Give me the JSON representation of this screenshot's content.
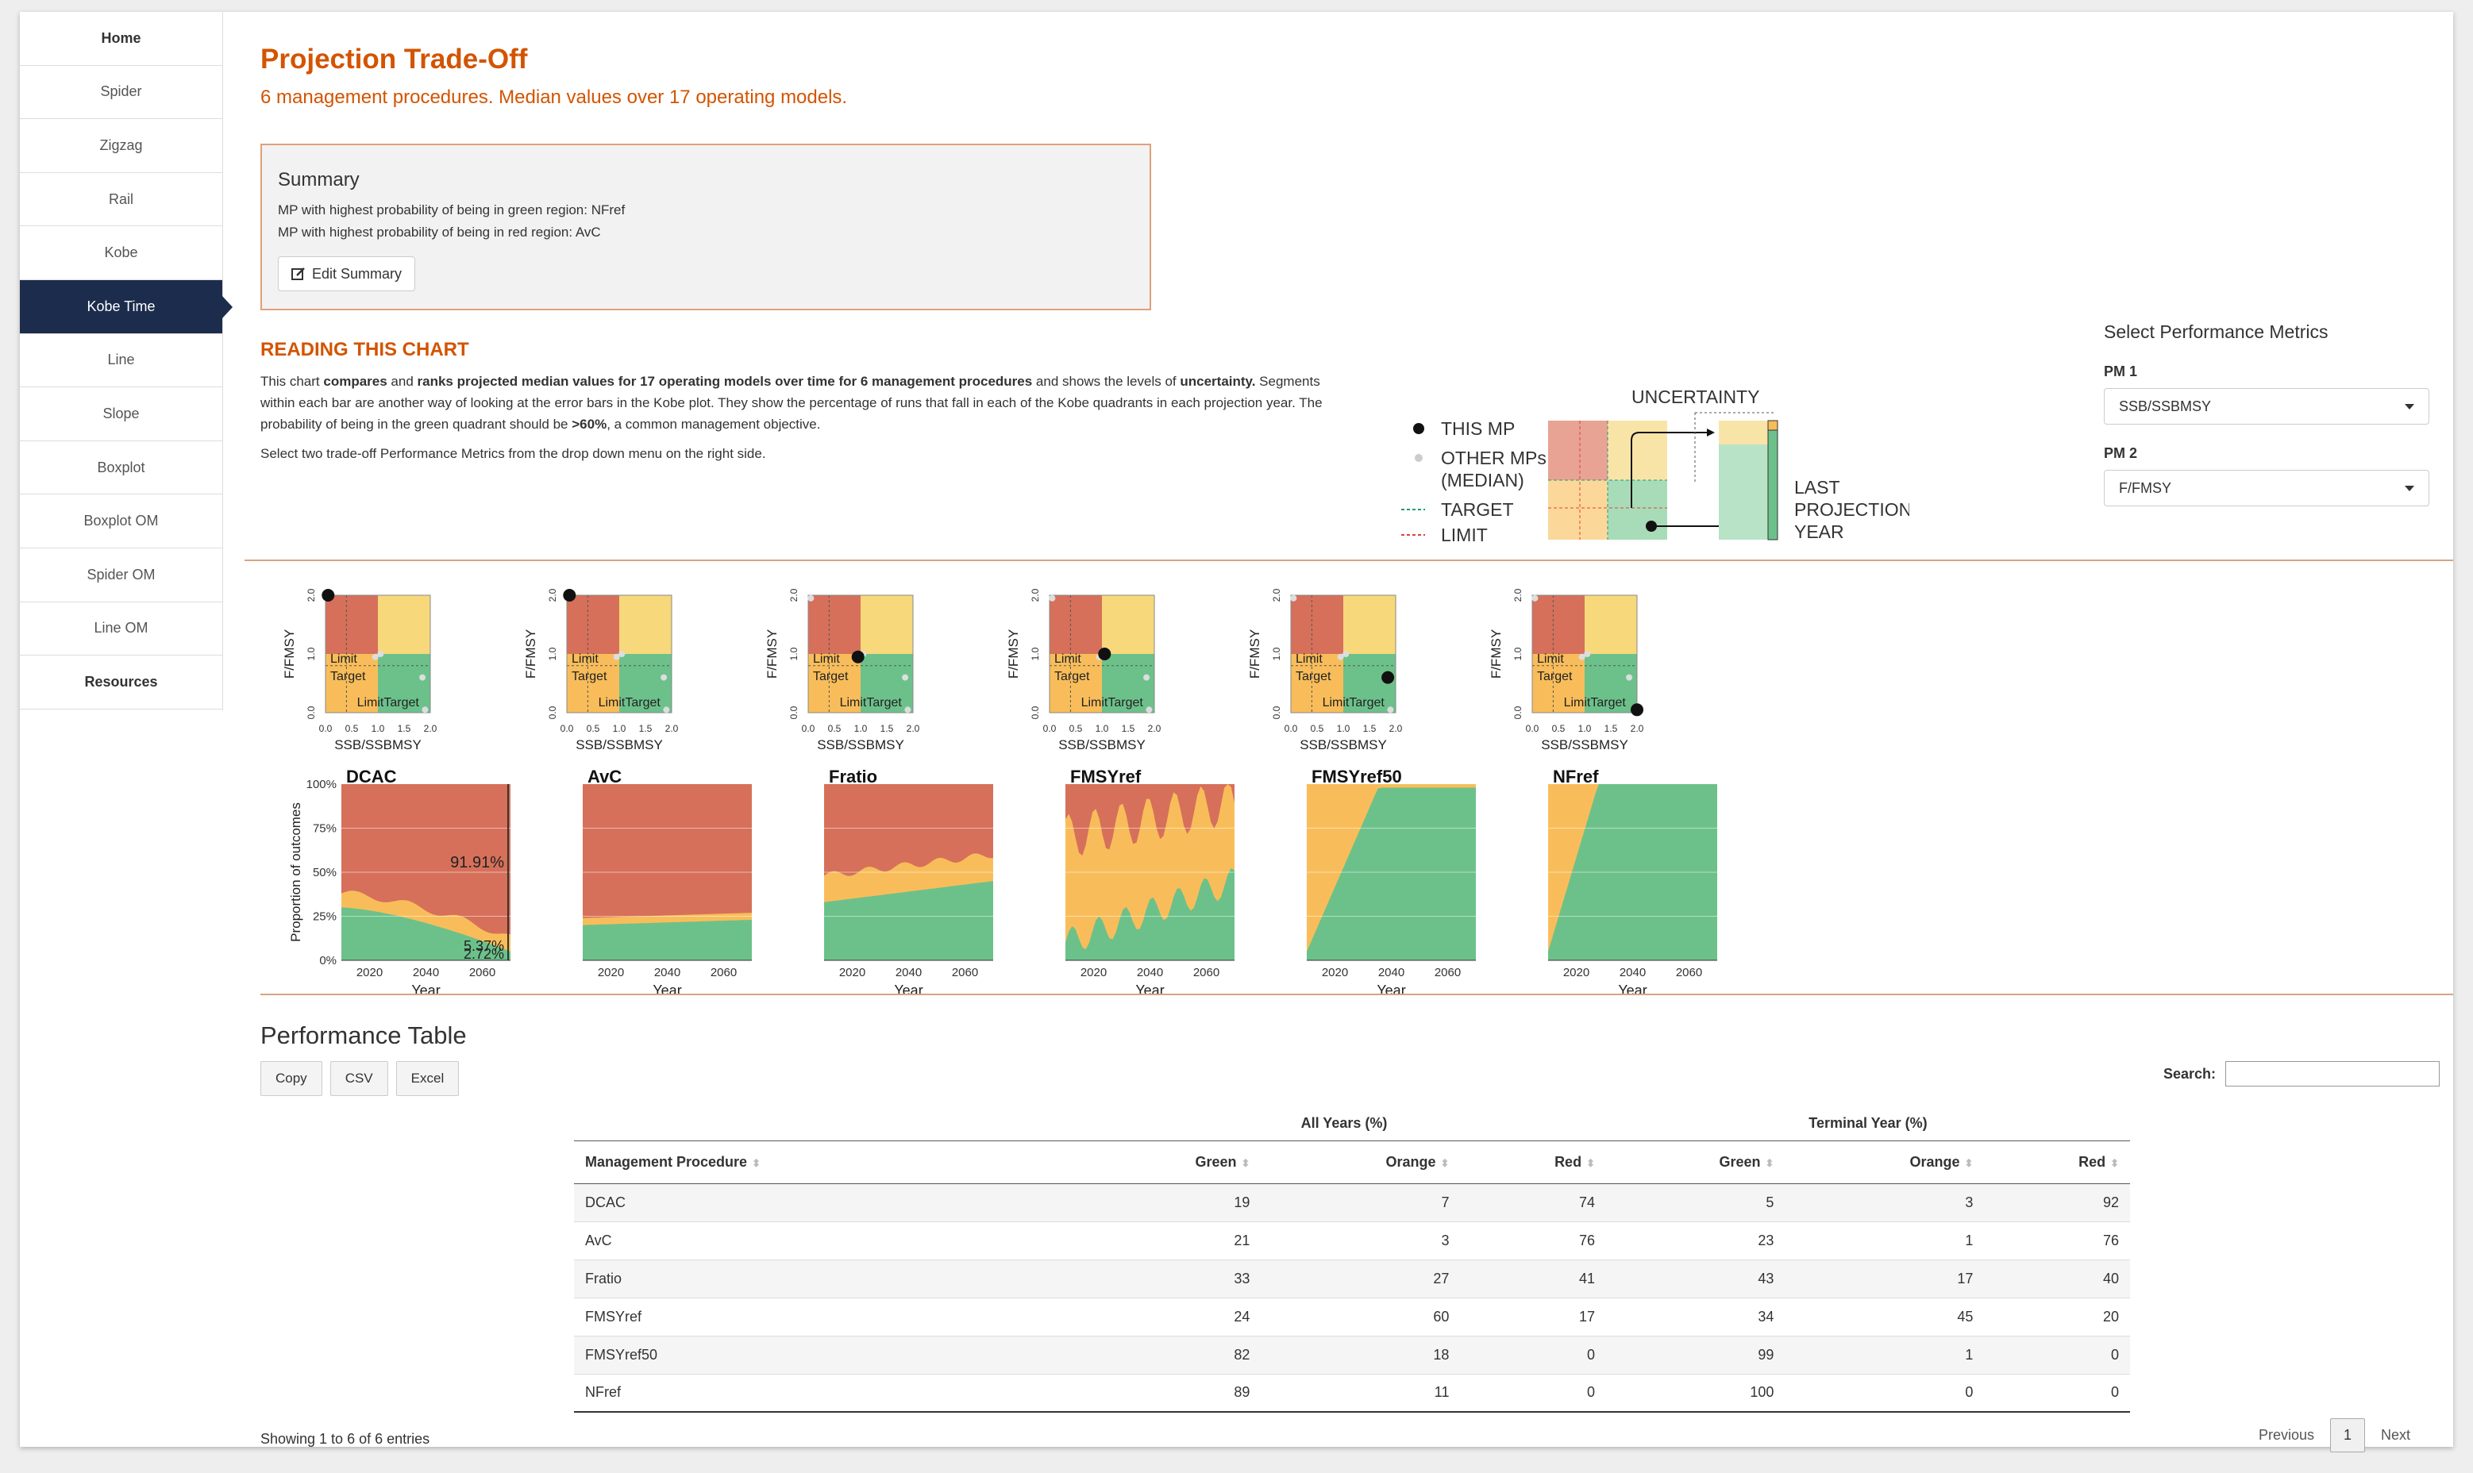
{
  "sidebar": {
    "items": [
      {
        "label": "Home",
        "bold": true
      },
      {
        "label": "Spider"
      },
      {
        "label": "Zigzag"
      },
      {
        "label": "Rail"
      },
      {
        "label": "Kobe"
      },
      {
        "label": "Kobe Time",
        "active": true
      },
      {
        "label": "Line"
      },
      {
        "label": "Slope"
      },
      {
        "label": "Boxplot"
      },
      {
        "label": "Boxplot OM"
      },
      {
        "label": "Spider OM"
      },
      {
        "label": "Line OM"
      },
      {
        "label": "Resources",
        "bold": true
      }
    ]
  },
  "header": {
    "title": "Projection Trade-Off",
    "subtitle": "6 management procedures. Median values over 17 operating models."
  },
  "summary": {
    "title": "Summary",
    "line1": "MP with highest probability of being in green region: NFref",
    "line2": "MP with highest probability of being in red region: AvC",
    "edit_label": "Edit Summary"
  },
  "reading": {
    "title": "READING THIS CHART",
    "p1a": "This chart ",
    "p1b": "compares",
    "p1c": " and ",
    "p1d": "ranks projected median values for 17 operating models over time for 6 management procedures",
    "p1e": " and shows the levels of ",
    "p1f": "uncertainty.",
    "p1g": " Segments within each bar are another way of looking at the error bars in the Kobe plot. They show the percentage of runs that fall in each of the Kobe quadrants in each projection year. The probability of being in the green quadrant should be ",
    "p1h": ">60%",
    "p1i": ", a common management objective.",
    "p2": "Select two trade-off Performance Metrics from the drop down menu on the right side."
  },
  "legend": {
    "this_mp": "THIS MP",
    "other_1": "OTHER MPs",
    "other_2": "(MEDIAN)",
    "target": "TARGET",
    "limit": "LIMIT",
    "uncertainty": "UNCERTAINTY",
    "last_1": "LAST",
    "last_2": "PROJECTION",
    "last_3": "YEAR"
  },
  "pm": {
    "heading": "Select Performance Metrics",
    "pm1_label": "PM 1",
    "pm1_value": "SSB/SSBMSY",
    "pm2_label": "PM 2",
    "pm2_value": "F/FMSY"
  },
  "colors": {
    "red": "#d6705a",
    "orange": "#f8bd5a",
    "yellow": "#f7d87a",
    "green": "#6cc18a",
    "accent": "#d35400",
    "nav_active": "#1c2c4c"
  },
  "chart_data": [
    {
      "type": "scatter",
      "panel": "kobe",
      "mps": [
        "DCAC",
        "AvC",
        "Fratio",
        "FMSYref",
        "FMSYref50",
        "NFref"
      ],
      "xlabel": "SSB/SSBMSY",
      "ylabel": "F/FMSY",
      "xticks": [
        "0.0",
        "0.5",
        "1.0",
        "1.5",
        "2.0"
      ],
      "yticks": [
        "0.0",
        "1.0",
        "2.0"
      ],
      "region_labels": [
        "Limit",
        "Target",
        "Limit",
        "Target"
      ],
      "this_mp": [
        {
          "x": 0.05,
          "y": 2.0
        },
        {
          "x": 0.05,
          "y": 2.0
        },
        {
          "x": 0.95,
          "y": 0.95
        },
        {
          "x": 1.05,
          "y": 1.0
        },
        {
          "x": 1.85,
          "y": 0.6
        },
        {
          "x": 2.0,
          "y": 0.05
        }
      ]
    },
    {
      "type": "area",
      "panel": "time",
      "ylabel": "Proportion of outcomes",
      "xlabel": "Year",
      "xticks": [
        "2020",
        "2040",
        "2060"
      ],
      "yticks": [
        "0%",
        "25%",
        "50%",
        "75%",
        "100%"
      ],
      "mps": [
        "DCAC",
        "AvC",
        "Fratio",
        "FMSYref",
        "FMSYref50",
        "NFref"
      ],
      "annotations": {
        "DCAC": [
          "91.91%",
          "5.37%",
          "2.72%"
        ]
      }
    }
  ],
  "table": {
    "title": "Performance Table",
    "buttons": [
      "Copy",
      "CSV",
      "Excel"
    ],
    "search_label": "Search:",
    "group_all": "All Years (%)",
    "group_terminal": "Terminal Year (%)",
    "headers": [
      "Management Procedure",
      "Green",
      "Orange",
      "Red",
      "Green",
      "Orange",
      "Red"
    ],
    "rows": [
      [
        "DCAC",
        "19",
        "7",
        "74",
        "5",
        "3",
        "92"
      ],
      [
        "AvC",
        "21",
        "3",
        "76",
        "23",
        "1",
        "76"
      ],
      [
        "Fratio",
        "33",
        "27",
        "41",
        "43",
        "17",
        "40"
      ],
      [
        "FMSYref",
        "24",
        "60",
        "17",
        "34",
        "45",
        "20"
      ],
      [
        "FMSYref50",
        "82",
        "18",
        "0",
        "99",
        "1",
        "0"
      ],
      [
        "NFref",
        "89",
        "11",
        "0",
        "100",
        "0",
        "0"
      ]
    ],
    "info": "Showing 1 to 6 of 6 entries",
    "prev": "Previous",
    "page": "1",
    "next": "Next"
  }
}
